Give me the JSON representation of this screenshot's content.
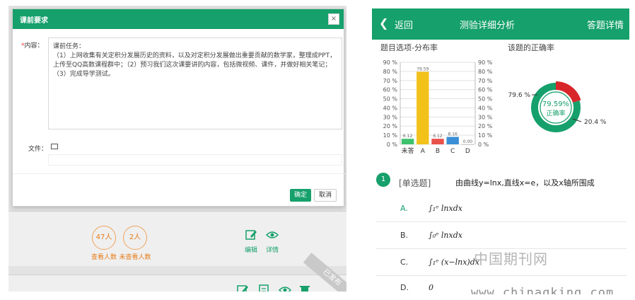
{
  "left": {
    "modal": {
      "title": "课前要求",
      "close": "×",
      "content_label": "内容：",
      "required_mark": "*",
      "content_text": "课前任务：\n（1）上网收集有关定积分发展历史的资料，以及对定积分发展做出重要贡献的数学家，整理成PPT，上传至QQ高数课程群中；（2）预习我们这次课要讲的内容，包括微视频、课件，并做好相关笔记；（3）完成导学测试。",
      "file_label": "文件：",
      "ok_label": "确定",
      "cancel_label": "取消"
    },
    "stats": [
      {
        "value": "47人",
        "label": "查看人数"
      },
      {
        "value": "2人",
        "label": "未查看人数"
      }
    ],
    "actions": [
      {
        "icon": "edit-icon",
        "label": "编辑"
      },
      {
        "icon": "eye-icon",
        "label": "详情"
      }
    ],
    "ribbon": "已发布"
  },
  "right": {
    "topbar": {
      "back_label": "返回",
      "title": "测验详细分析",
      "action_label": "答题详情",
      "color": "#16a06b"
    },
    "section_left": "题目选项-分布率",
    "section_right": "该题的正确率",
    "question": {
      "number": "1",
      "type": "[单选题]",
      "stem": "由曲线y=lnx,直线x=e，以及x轴所围成",
      "options": [
        {
          "letter": "A.",
          "text": "∫₁ᵉ lnxdx",
          "color": "#16a06b"
        },
        {
          "letter": "B.",
          "text": "∫₀ᵉ lnxdx",
          "color": "#333333"
        },
        {
          "letter": "C.",
          "text": "∫₁ᵉ (x−lnx)dx",
          "color": "#333333"
        },
        {
          "letter": "D.",
          "text": "0",
          "color": "#333333"
        }
      ]
    },
    "watermark": "中国期刊网",
    "watermark_url": "www.chinaqking.com"
  },
  "chart_data": [
    {
      "type": "bar",
      "categories": [
        "未答",
        "A",
        "B",
        "C",
        "D"
      ],
      "values": [
        6.12,
        79.59,
        6.12,
        8.16,
        0.0
      ],
      "ylim": [
        0,
        90
      ],
      "yticks": [
        "0 %",
        "10 %",
        "20 %",
        "30 %",
        "40 %",
        "50 %",
        "60 %",
        "70 %",
        "80 %",
        "90 %"
      ],
      "colors": [
        "#3ec26e",
        "#f2c21b",
        "#e8524a",
        "#3a8fd6",
        "#999999"
      ],
      "data_labels": [
        "6.12",
        "79.59",
        "6.12",
        "8.16",
        "0.00"
      ],
      "grid": true
    },
    {
      "type": "pie",
      "labels": [
        "正确率",
        ""
      ],
      "values": [
        79.6,
        20.4
      ],
      "slice_labels": [
        "79.6 %",
        "20.4 %"
      ],
      "center_value": "79.59%",
      "center_label": "正确率",
      "colors": [
        "#16a06b",
        "#d8262b"
      ]
    }
  ]
}
